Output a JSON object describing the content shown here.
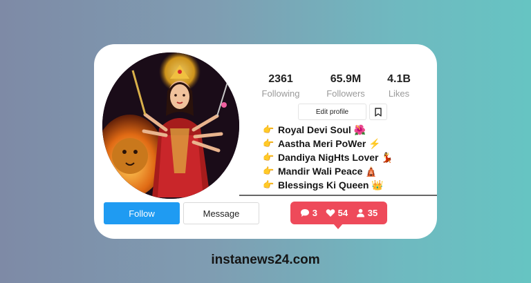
{
  "profile": {
    "stats": [
      {
        "value": "2361",
        "label": "Following"
      },
      {
        "value": "65.9M",
        "label": "Followers"
      },
      {
        "value": "4.1B",
        "label": "Likes"
      }
    ],
    "edit_profile_label": "Edit profile",
    "bio": [
      {
        "icon": "👉",
        "text": "Royal Devi Soul 🌺"
      },
      {
        "icon": "👉",
        "text": "Aastha Meri PoWer ⚡"
      },
      {
        "icon": "👉",
        "text": "Dandiya NigHts Lover 💃"
      },
      {
        "icon": "👉",
        "text": "Mandir Wali Peace 🛕"
      },
      {
        "icon": "👉",
        "text": "Blessings Ki Queen 👑"
      }
    ],
    "follow_label": "Follow",
    "message_label": "Message"
  },
  "notifications": {
    "comments": "3",
    "likes": "54",
    "followers": "35"
  },
  "colors": {
    "follow": "#1f9bf2",
    "notification": "#ee4a5a"
  },
  "footer": {
    "site": "instanews24.com"
  }
}
